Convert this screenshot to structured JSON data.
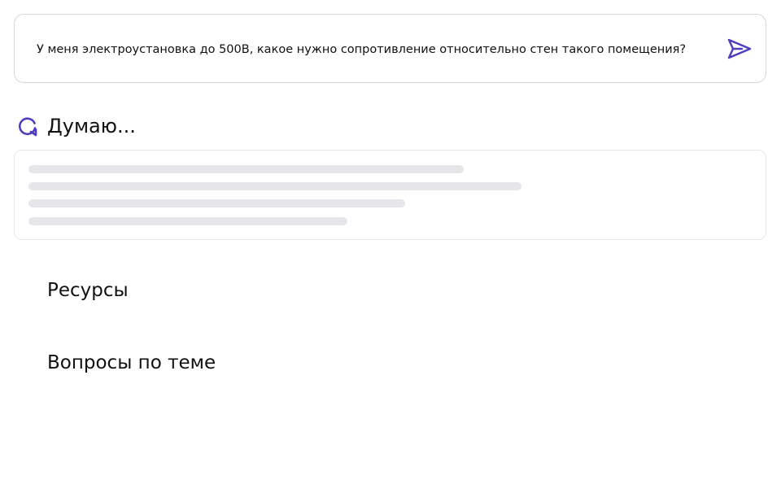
{
  "query": {
    "text": "У меня электроустановка до 500В, какое нужно сопротивление относительно стен такого помещения?",
    "send_icon": "send-icon"
  },
  "status": {
    "label": "Думаю...",
    "icon": "loading-refresh-icon"
  },
  "sections": {
    "resources_title": "Ресурсы",
    "related_title": "Вопросы по теме"
  },
  "colors": {
    "accent": "#4b3fbf",
    "border": "#d6d6da",
    "skeleton": "#e6e6ea",
    "text": "#111111"
  }
}
